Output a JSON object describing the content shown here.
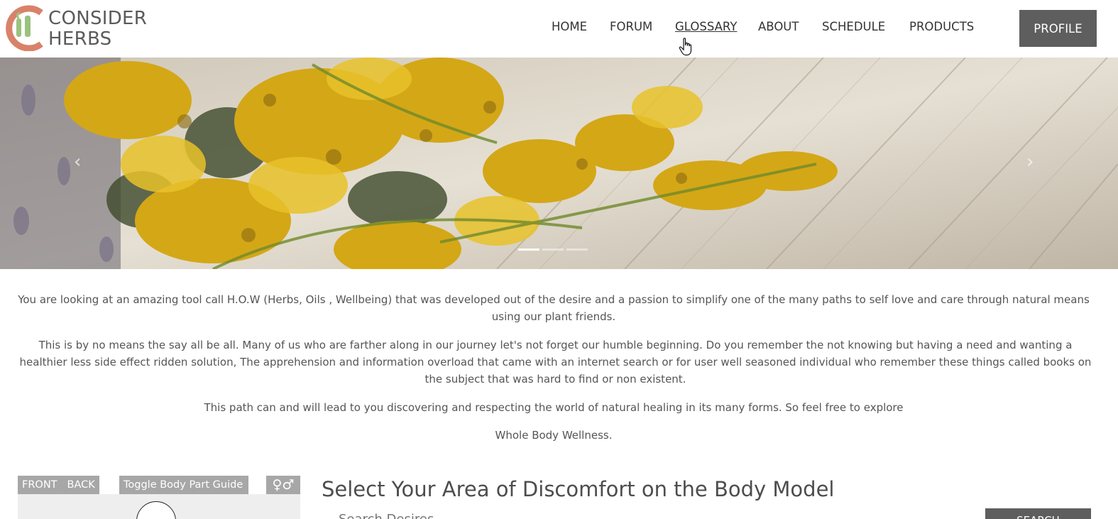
{
  "brand": {
    "line1": "CONSIDER",
    "line2": "HERBS",
    "colors": {
      "ring": "#d9826a",
      "leaf": "#9bc27f",
      "text": "#5a5a5a"
    }
  },
  "nav": {
    "items": [
      {
        "label": "HOME",
        "active": false
      },
      {
        "label": "FORUM",
        "active": false
      },
      {
        "label": "GLOSSARY",
        "active": true
      },
      {
        "label": "ABOUT",
        "active": false
      },
      {
        "label": "SCHEDULE",
        "active": false
      },
      {
        "label": "PRODUCTS",
        "active": false
      }
    ],
    "profile_label": "PROFILE"
  },
  "hero": {
    "prev_icon": "chevron-left-icon",
    "next_icon": "chevron-right-icon",
    "prev_glyph": "‹",
    "next_glyph": "›",
    "slide_count": 3,
    "active_slide": 1
  },
  "intro": {
    "paragraphs": [
      "You are looking at an amazing tool call H.O.W (Herbs, Oils , Wellbeing) that was developed out of the desire and a passion to simplify one of the many paths to self love and care through natural means using our plant friends.",
      "This is by no means the say all be all. Many of us who are farther along in our journey let's not forget our humble beginning. Do you remember the not knowing but having a need and wanting a healthier less side effect ridden solution, The apprehension and information overload that came with an internet search or for user well seasoned individual who remember these things called books on the subject that was hard to find or non existent.",
      "This path can and will lead to you discovering and respecting the world of natural healing in its many forms. So feel free to explore",
      "Whole Body Wellness."
    ]
  },
  "body_model": {
    "front_label": "FRONT",
    "back_label": "BACK",
    "toggle_label": "Toggle Body Part Guide",
    "gender_glyph": "♀♂"
  },
  "discomfort": {
    "title": "Select Your Area of Discomfort on the Body Model",
    "search_placeholder": "Search Desires...",
    "search_button": "SEARCH"
  }
}
